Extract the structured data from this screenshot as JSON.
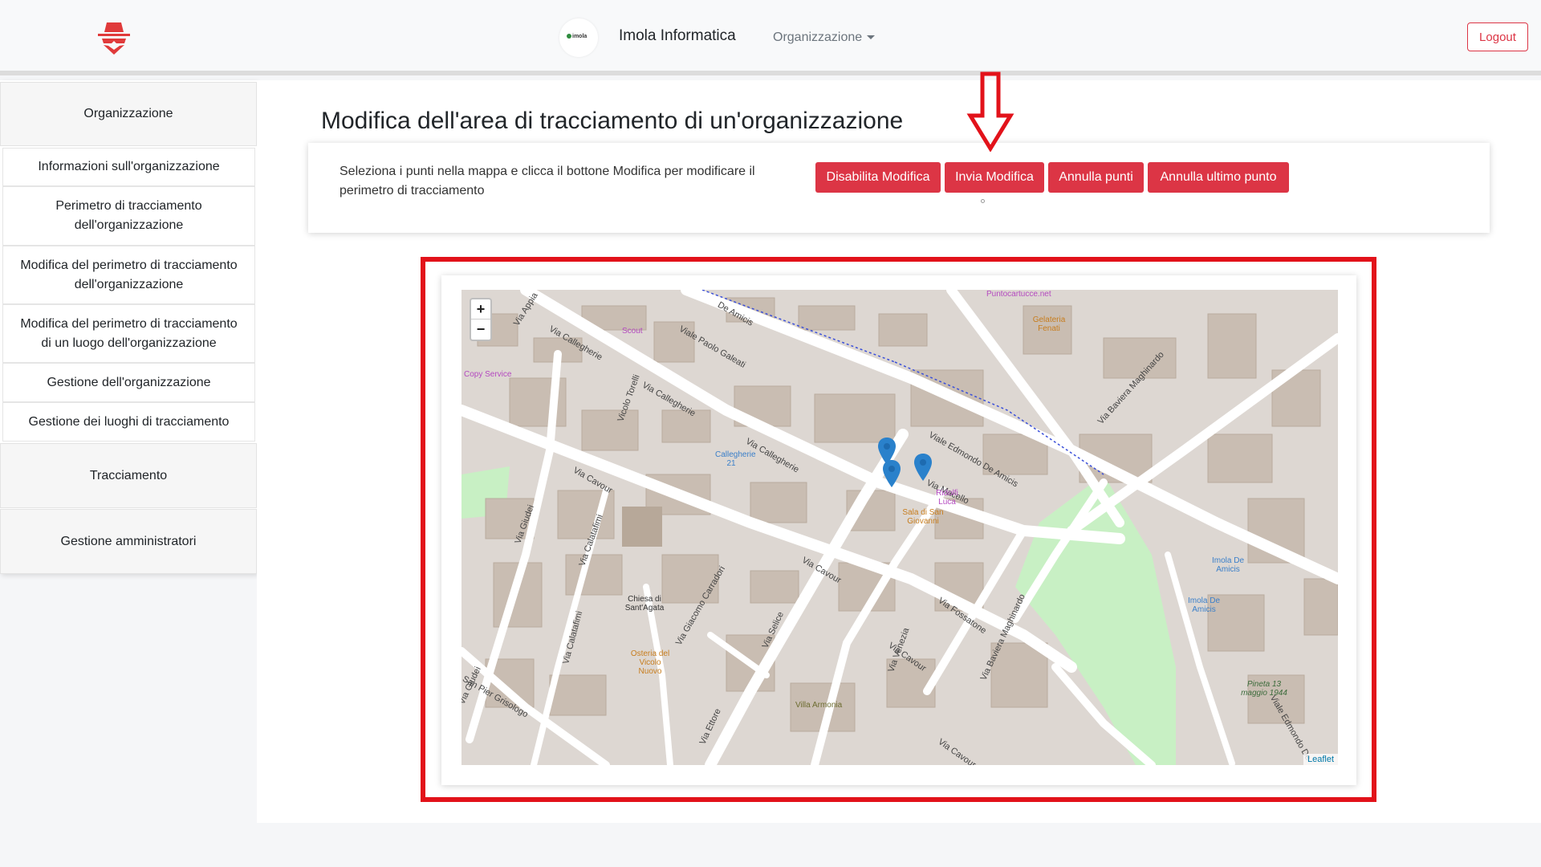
{
  "navbar": {
    "org_logo_text": "imola",
    "org_name": "Imola Informatica",
    "dropdown_label": "Organizzazione",
    "logout_label": "Logout"
  },
  "sidebar": {
    "section_org": "Organizzazione",
    "items": [
      {
        "label": "Informazioni sull'organizzazione"
      },
      {
        "label": "Perimetro di tracciamento dell'organizzazione"
      },
      {
        "label": "Modifica del perimetro di tracciamento dell'organizzazione"
      },
      {
        "label": "Modifica del perimetro di tracciamento di un luogo dell'organizzazione"
      },
      {
        "label": "Gestione dell'organizzazione"
      },
      {
        "label": "Gestione dei luoghi di tracciamento"
      }
    ],
    "section_tracking": "Tracciamento",
    "section_admins": "Gestione amministratori"
  },
  "main": {
    "title": "Modifica dell'area di tracciamento di un'organizzazione",
    "instructions": "Seleziona i punti nella mappa e clicca il bottone Modifica per modificare il perimetro di tracciamento",
    "buttons": {
      "disable": "Disabilita Modifica",
      "send": "Invia Modifica",
      "cancel_points": "Annulla punti",
      "cancel_last": "Annulla ultimo punto"
    }
  },
  "map": {
    "zoom_in": "+",
    "zoom_out": "−",
    "attribution": "Leaflet",
    "streets": [
      "Via Appia",
      "Via Callegherie",
      "Viale Paolo Galeati",
      "Via Callegherie",
      "Via Callegherie",
      "Via Cavour",
      "Via Cavour",
      "Via Cavour",
      "Via Giudei",
      "Via Calatafimi",
      "Via Calatafimi",
      "Via Giacomo Carradori",
      "Via Selice",
      "Via Ettore",
      "Via Venezia",
      "Via Fossatone",
      "Via Baviera Maghinardo",
      "Viale Edmondo De Amicis",
      "Via Macello",
      "Via Baviera Maghinardo",
      "San Pier Grisologo",
      "Vicolo Torelli",
      "De Amicis",
      "Viale Edmondo De",
      "Via Giudei",
      "Via Cavour"
    ],
    "pois": [
      "Puntocartucce.net",
      "Gelateria Fenati",
      "Scout",
      "Copy Service",
      "Callegherie 21",
      "Ridolfi Luca",
      "Sala di San Giovanni",
      "Chiesa di Sant'Agata",
      "Osteria del Vicolo Nuovo",
      "Villa Armonia",
      "Imola De Amicis",
      "Imola De Amicis",
      "Pineta 13 maggio 1944"
    ],
    "colors": {
      "land": "#ddd7d2",
      "building": "#c9bdb2",
      "road": "#ffffff",
      "park": "#c8f0c4",
      "marker": "#2a81cb"
    },
    "marker_count": 3
  },
  "annotation": {
    "arrow_color": "#e2121a",
    "box_color": "#e2121a"
  }
}
